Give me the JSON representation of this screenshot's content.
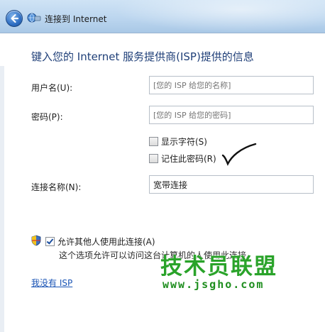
{
  "window": {
    "title": "连接到 Internet"
  },
  "heading": "键入您的 Internet 服务提供商(ISP)提供的信息",
  "form": {
    "username": {
      "label": "用户名(U):",
      "placeholder": "[您的 ISP 给您的名称]"
    },
    "password": {
      "label": "密码(P):",
      "placeholder": "[您的 ISP 给您的密码]"
    },
    "show_chars": {
      "label": "显示字符(S)",
      "checked": false
    },
    "remember": {
      "label": "记住此密码(R)",
      "checked": false
    },
    "connection_name": {
      "label": "连接名称(N):",
      "value": "宽带连接"
    }
  },
  "allow_others": {
    "label": "允许其他人使用此连接(A)",
    "checked": true,
    "description": "这个选项允许可以访问这台计算机的人使用此连接。"
  },
  "no_isp_link": "我没有 ISP",
  "watermark": {
    "main": "技术员联盟",
    "sub": "www.jsgho.com"
  },
  "icons": [
    "back-arrow-icon",
    "network-icon",
    "shield-icon",
    "checkmark-annotation-icon"
  ],
  "colors": {
    "heading": "#1f3f78",
    "link": "#1a54b5",
    "watermark": "#2aa32a"
  }
}
